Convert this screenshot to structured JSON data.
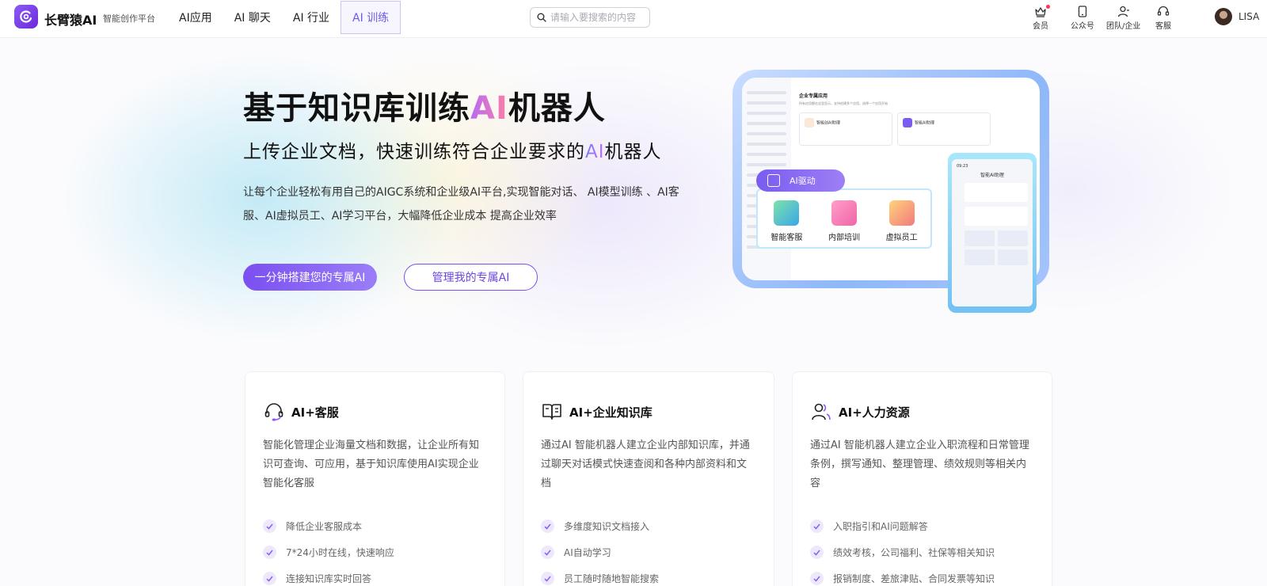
{
  "brand": {
    "name": "长臂猿AI",
    "tagline": "智能创作平台"
  },
  "nav": [
    {
      "label": "AI应用"
    },
    {
      "label": "AI 聊天"
    },
    {
      "label": "AI 行业"
    },
    {
      "label": "AI 训练",
      "active": true
    }
  ],
  "search": {
    "placeholder": "请输入要搜索的内容"
  },
  "utils": [
    {
      "label": "会员",
      "icon": "crown-icon"
    },
    {
      "label": "公众号",
      "icon": "phone-icon"
    },
    {
      "label": "团队/企业",
      "icon": "team-icon"
    },
    {
      "label": "客服",
      "icon": "headset-icon"
    }
  ],
  "user": {
    "name": "LISA"
  },
  "hero": {
    "title_pre": "基于知识库训练",
    "title_hl": "AI",
    "title_post": "机器人",
    "subtitle_pre": "上传企业文档，快速训练符合企业要求的",
    "subtitle_hl": "AI",
    "subtitle_post": "机器人",
    "desc": "让每个企业轻松有用自己的AIGC系统和企业级AI平台,实现智能对话、 AI模型训练 、AI客服、AI虚拟员工、AI学习平台，大幅降低企业成本 提高企业效率",
    "btn_primary": "一分钟搭建您的专属AI",
    "btn_secondary": "管理我的专属AI"
  },
  "illustration": {
    "laptop_title": "企业专属应用",
    "laptop_desc": "所有应用都在这里显示，支持创建多个应用，选择一个应用开始",
    "laptop_cards": [
      "智能创AI助理",
      "智能AI助理"
    ],
    "badge": "AI驱动",
    "panel_items": [
      "智能客服",
      "内部培训",
      "虚拟员工"
    ],
    "phone_title": "智能AI助理",
    "phone_time": "09:23"
  },
  "cards": [
    {
      "title": "AI+客服",
      "icon": "headset-icon",
      "desc": "智能化管理企业海量文档和数据，让企业所有知识可查询、可应用，基于知识库使用AI实现企业智能化客服",
      "items": [
        "降低企业客服成本",
        "7*24小时在线，快速响应",
        "连接知识库实时回答"
      ]
    },
    {
      "title": "AI+企业知识库",
      "icon": "book-icon",
      "desc": "通过AI 智能机器人建立企业内部知识库，并通过聊天对话模式快速查阅和各种内部资料和文档",
      "items": [
        "多维度知识文档接入",
        "AI自动学习",
        "员工随时随地智能搜索"
      ]
    },
    {
      "title": "AI+人力资源",
      "icon": "people-icon",
      "desc": "通过AI 智能机器人建立企业入职流程和日常管理条例，撰写通知、整理管理、绩效规则等相关内容",
      "items": [
        "入职指引和AI问题解答",
        "绩效考核，公司福利、社保等相关知识",
        "报销制度、差旅津贴、合同发票等知识"
      ]
    }
  ],
  "colors": {
    "accent": "#7b4ff0",
    "nav_active": "#6b5be6",
    "text": "#222222"
  }
}
